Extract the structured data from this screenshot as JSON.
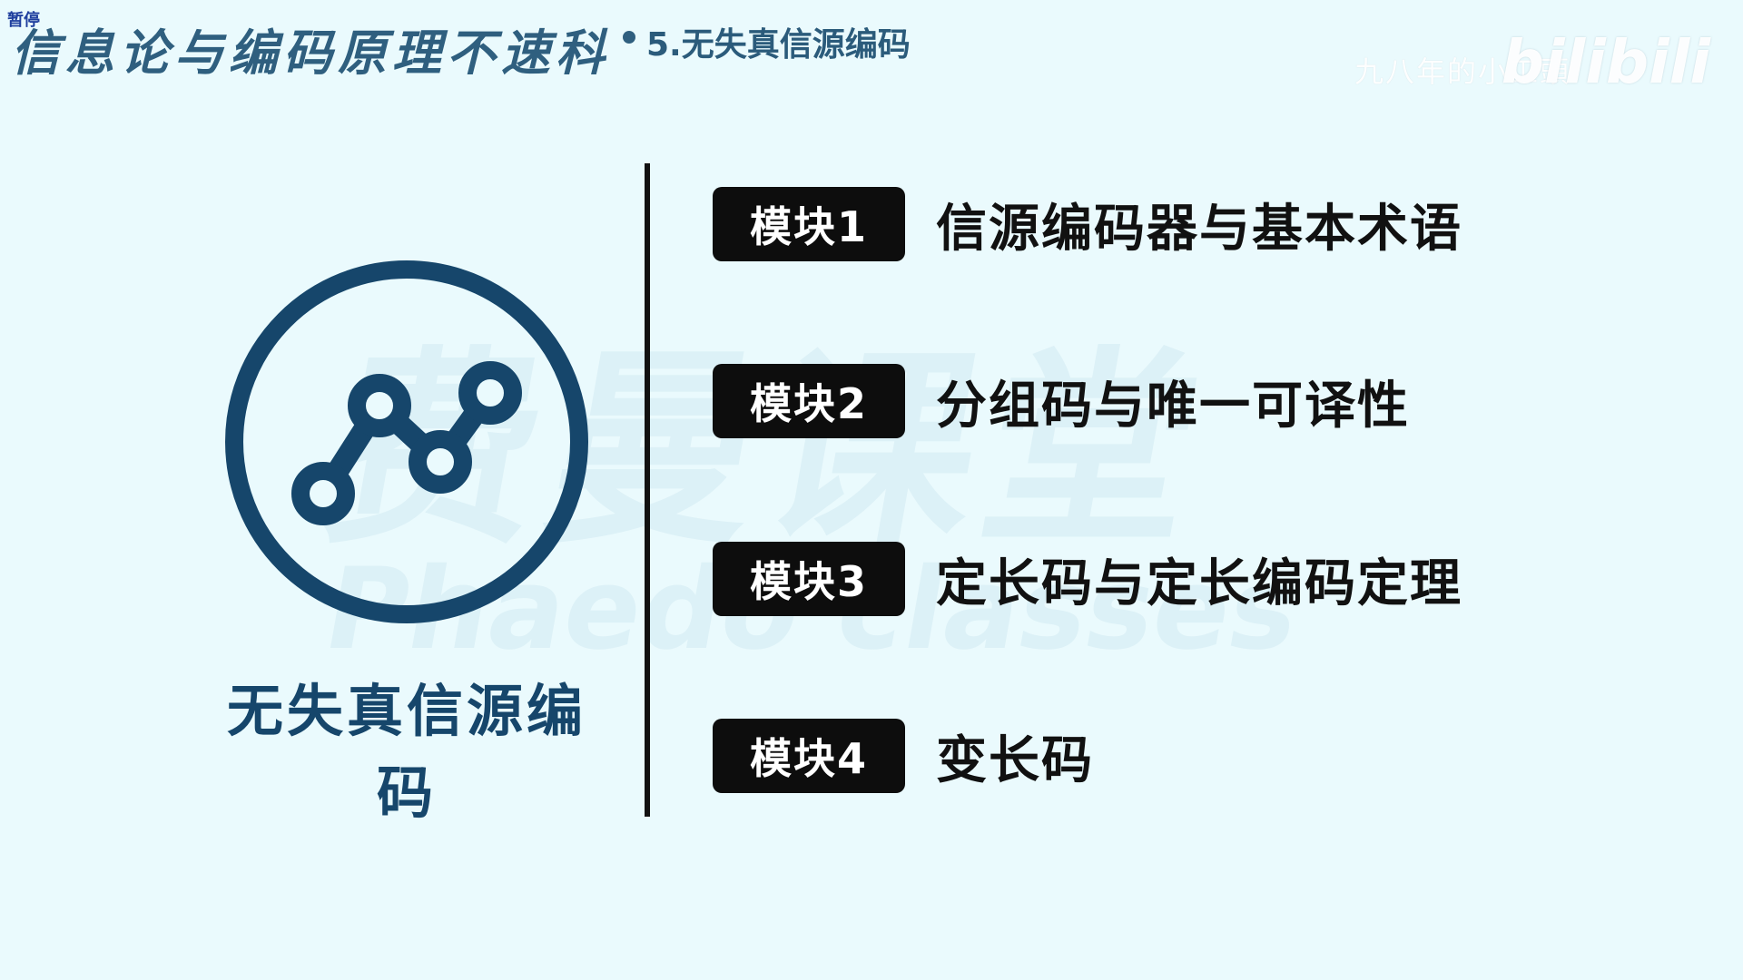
{
  "header": {
    "badge": "暂停",
    "title": "信息论与编码原理不速科",
    "subtitle": "5.无失真信源编码"
  },
  "watermark": {
    "site_text": "九八年的小工頭",
    "brand_text": "bilibili",
    "background_cn": "费曼课堂",
    "background_en": "Phaedo classes"
  },
  "topic": {
    "title": "无失真信源编码",
    "icon": "line-chart-icon",
    "accent_color": "#16466b"
  },
  "modules": [
    {
      "badge": "模块1",
      "label": "信源编码器与基本术语"
    },
    {
      "badge": "模块2",
      "label": "分组码与唯一可译性"
    },
    {
      "badge": "模块3",
      "label": "定长码与定长编码定理"
    },
    {
      "badge": "模块4",
      "label": "变长码"
    }
  ]
}
